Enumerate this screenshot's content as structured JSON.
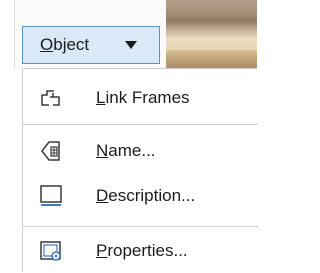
{
  "toolbar": {
    "object_button": {
      "label": "Object",
      "mnemonic": "O",
      "rest": "bject"
    }
  },
  "menu": {
    "items": [
      {
        "label": "Link Frames",
        "mnemonic": "L",
        "rest": "ink Frames",
        "icon": "link-frames-icon"
      },
      {
        "label": "Name...",
        "mnemonic": "N",
        "rest": "ame...",
        "icon": "name-icon"
      },
      {
        "label": "Description...",
        "mnemonic": "D",
        "rest": "escription...",
        "icon": "description-icon"
      },
      {
        "label": "Properties...",
        "mnemonic": "P",
        "rest": "roperties...",
        "icon": "properties-icon"
      }
    ]
  },
  "colors": {
    "button_background": "#d9e9f7",
    "button_border": "#5f8fbd",
    "icon_accent": "#3b7bbf"
  }
}
